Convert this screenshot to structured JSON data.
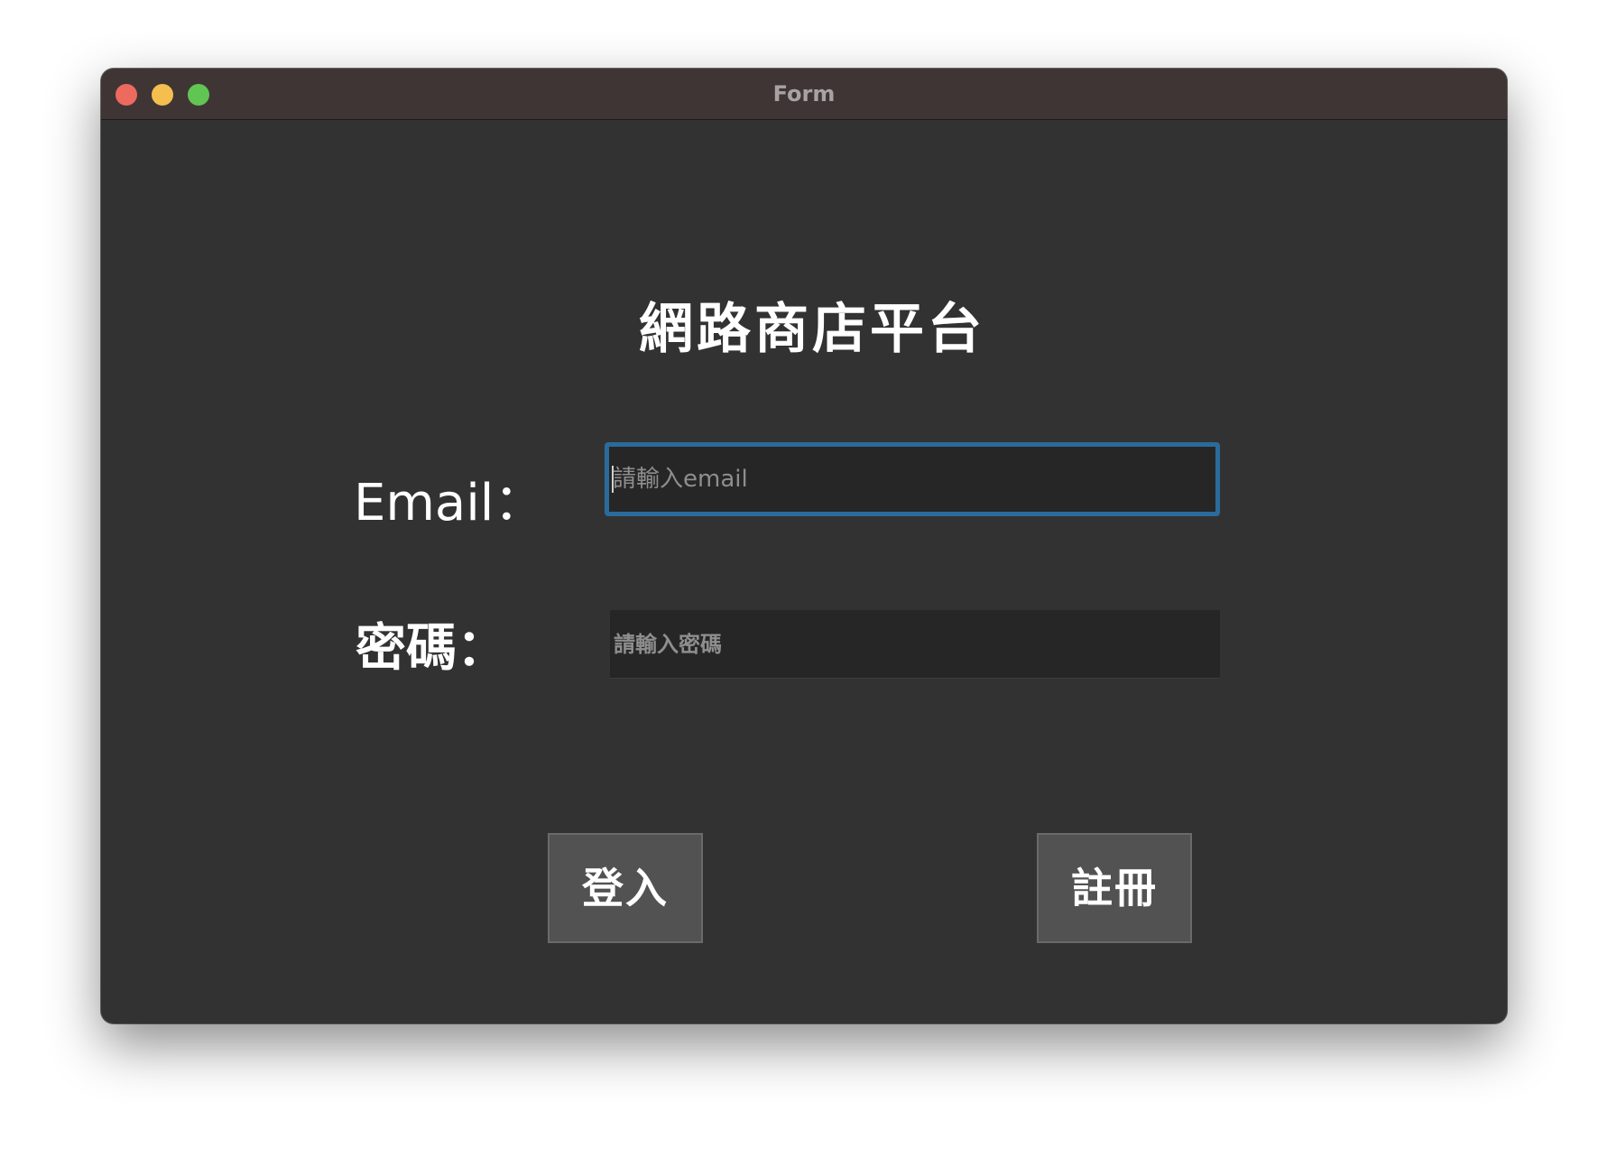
{
  "window": {
    "title": "Form"
  },
  "app": {
    "title": "網路商店平台"
  },
  "form": {
    "email_label": "Email：",
    "email_placeholder": "請輸入email",
    "email_value": "",
    "password_label": "密碼：",
    "password_placeholder": "請輸入密碼",
    "password_value": ""
  },
  "buttons": {
    "login_label": "登入",
    "register_label": "註冊"
  },
  "colors": {
    "window_bg": "#323232",
    "titlebar_bg": "#403535",
    "input_bg": "#262626",
    "focus_ring": "#2b6b9b",
    "button_bg": "#525252",
    "close": "#ed6a5e",
    "minimize": "#f5bf4f",
    "maximize": "#61c554"
  }
}
